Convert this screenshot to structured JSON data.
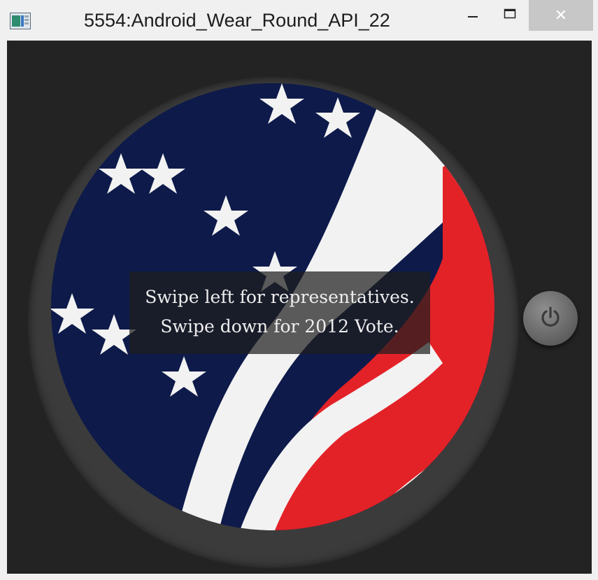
{
  "window": {
    "title": "5554:Android_Wear_Round_API_22",
    "icons": {
      "app": "emulator-app-icon",
      "minimize": "minimize-icon",
      "maximize": "maximize-icon",
      "close": "close-icon"
    },
    "close_glyph": "✕"
  },
  "watch": {
    "background": "american-flag-wallpaper",
    "message_lines": [
      "Swipe left for representatives.",
      "Swipe down for 2012 Vote."
    ],
    "colors": {
      "flag_blue": "#0d1a4a",
      "flag_red": "#e32228",
      "flag_white": "#f2f2f2"
    }
  },
  "power_button": {
    "icon": "power-icon"
  }
}
